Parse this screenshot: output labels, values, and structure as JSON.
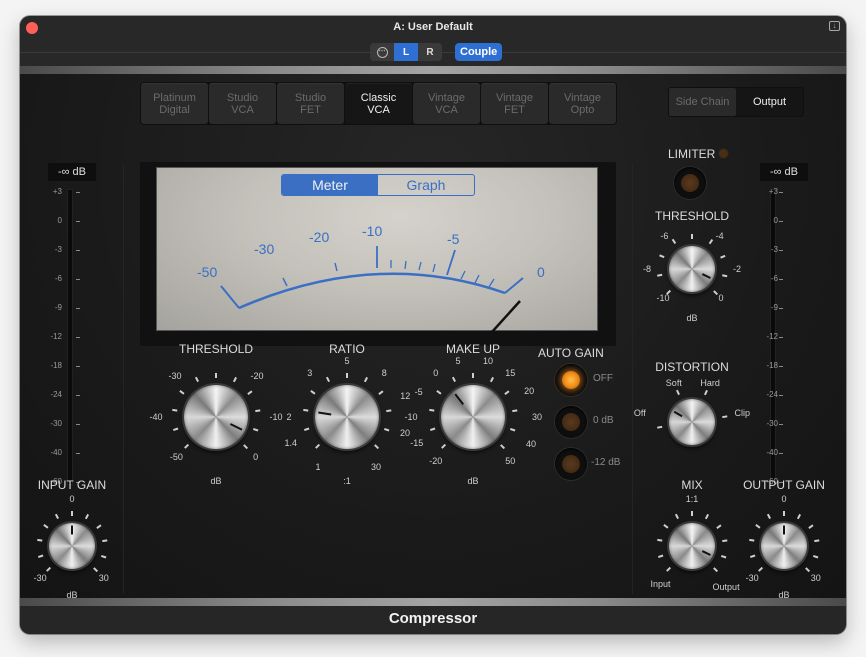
{
  "window": {
    "title": "A: User Default",
    "link_icon": "link-icon",
    "channels": [
      {
        "label": "L",
        "active": true
      },
      {
        "label": "R",
        "active": false
      }
    ],
    "couple_label": "Couple",
    "footer_title": "Compressor"
  },
  "models": [
    {
      "line1": "Platinum",
      "line2": "Digital",
      "active": false
    },
    {
      "line1": "Studio",
      "line2": "VCA",
      "active": false
    },
    {
      "line1": "Studio",
      "line2": "FET",
      "active": false
    },
    {
      "line1": "Classic",
      "line2": "VCA",
      "active": true
    },
    {
      "line1": "Vintage",
      "line2": "VCA",
      "active": false
    },
    {
      "line1": "Vintage",
      "line2": "FET",
      "active": false
    },
    {
      "line1": "Vintage",
      "line2": "Opto",
      "active": false
    }
  ],
  "routing": [
    {
      "label": "Side Chain",
      "active": false
    },
    {
      "label": "Output",
      "active": true
    }
  ],
  "meter_scale": [
    "+3",
    "0",
    "-3",
    "-6",
    "-9",
    "-12",
    "-18",
    "-24",
    "-30",
    "-40",
    "-60"
  ],
  "input_meter": {
    "readout": "-∞ dB"
  },
  "output_meter": {
    "readout": "-∞ dB"
  },
  "vu": {
    "view_options": [
      {
        "label": "Meter",
        "active": true
      },
      {
        "label": "Graph",
        "active": false
      }
    ],
    "scale_labels": [
      "-50",
      "-30",
      "-20",
      "-10",
      "-5",
      "0"
    ],
    "needle_db": 0
  },
  "knobs": {
    "threshold": {
      "label": "THRESHOLD",
      "ticks": [
        "-30",
        "-20",
        "-40",
        "-10",
        "-50",
        "0"
      ],
      "unit": "dB",
      "value_fraction": 0.93
    },
    "ratio": {
      "label": "RATIO",
      "ticks": [
        "5",
        "8",
        "3",
        "12",
        "2",
        "20",
        "1.4",
        "1",
        "30"
      ],
      "unit": ":1",
      "value_fraction": 0.2
    },
    "makeup": {
      "label": "MAKE UP",
      "ticks": [
        "5",
        "10",
        "0",
        "15",
        "-5",
        "20",
        "-10",
        "30",
        "-15",
        "40",
        "-20",
        "50"
      ],
      "unit": "dB",
      "value_fraction": 0.36
    },
    "limiter_threshold": {
      "label": "THRESHOLD",
      "ticks": [
        "-6",
        "-4",
        "-8",
        "-2",
        "-10",
        "0"
      ],
      "unit": "dB",
      "value_fraction": 0.93
    },
    "distortion": {
      "label": "DISTORTION",
      "ticks": [
        "Soft",
        "Hard",
        "Off",
        "Clip"
      ],
      "value": "Off"
    },
    "mix": {
      "label": "MIX",
      "ticks": [
        "1:1",
        "Input",
        "Output"
      ],
      "value_fraction": 0.93
    },
    "input_gain": {
      "label": "INPUT GAIN",
      "ticks": [
        "0",
        "-30",
        "30"
      ],
      "unit": "dB",
      "value_db": 0
    },
    "output_gain": {
      "label": "OUTPUT GAIN",
      "ticks": [
        "0",
        "-30",
        "30"
      ],
      "unit": "dB",
      "value_db": 0
    }
  },
  "auto_gain": {
    "label": "AUTO GAIN",
    "options": [
      {
        "label": "OFF",
        "on": true
      },
      {
        "label": "0 dB",
        "on": false
      },
      {
        "label": "-12 dB",
        "on": false
      }
    ]
  },
  "limiter": {
    "label": "LIMITER",
    "enabled": false
  }
}
